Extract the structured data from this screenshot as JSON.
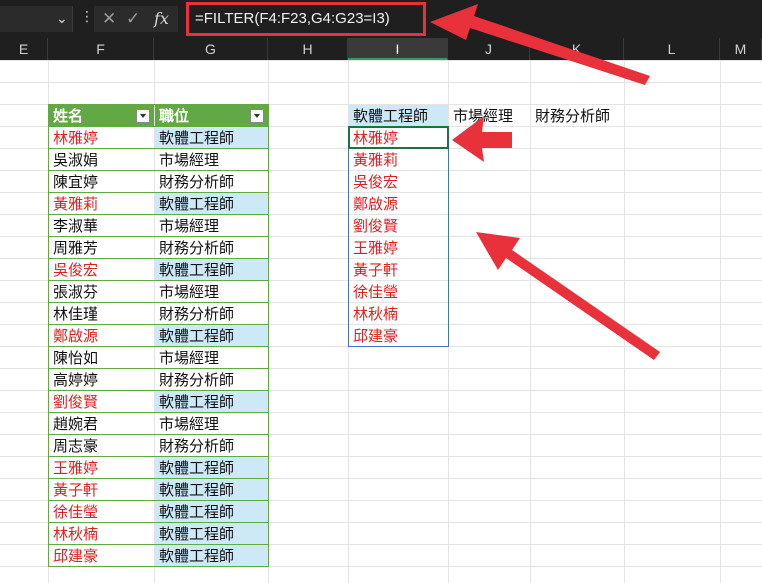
{
  "formula_bar": {
    "formula": "=FILTER(F4:F23,G4:G23=I3)",
    "fx_label": "fx"
  },
  "columns": [
    "E",
    "F",
    "G",
    "H",
    "I",
    "J",
    "K",
    "L",
    "M"
  ],
  "selected_column": "I",
  "table": {
    "headers": [
      "姓名",
      "職位"
    ],
    "rows": [
      {
        "name": "林雅婷",
        "role": "軟體工程師",
        "match": true
      },
      {
        "name": "吳淑娟",
        "role": "市場經理",
        "match": false
      },
      {
        "name": "陳宜婷",
        "role": "財務分析師",
        "match": false
      },
      {
        "name": "黃雅莉",
        "role": "軟體工程師",
        "match": true
      },
      {
        "name": "李淑華",
        "role": "市場經理",
        "match": false
      },
      {
        "name": "周雅芳",
        "role": "財務分析師",
        "match": false
      },
      {
        "name": "吳俊宏",
        "role": "軟體工程師",
        "match": true
      },
      {
        "name": "張淑芬",
        "role": "市場經理",
        "match": false
      },
      {
        "name": "林佳瑾",
        "role": "財務分析師",
        "match": false
      },
      {
        "name": "鄭啟源",
        "role": "軟體工程師",
        "match": true
      },
      {
        "name": "陳怡如",
        "role": "市場經理",
        "match": false
      },
      {
        "name": "高婷婷",
        "role": "財務分析師",
        "match": false
      },
      {
        "name": "劉俊賢",
        "role": "軟體工程師",
        "match": true
      },
      {
        "name": "趙婉君",
        "role": "市場經理",
        "match": false
      },
      {
        "name": "周志豪",
        "role": "財務分析師",
        "match": false
      },
      {
        "name": "王雅婷",
        "role": "軟體工程師",
        "match": true
      },
      {
        "name": "黃子軒",
        "role": "軟體工程師",
        "match": true
      },
      {
        "name": "徐佳瑩",
        "role": "軟體工程師",
        "match": true
      },
      {
        "name": "林秋楠",
        "role": "軟體工程師",
        "match": true
      },
      {
        "name": "邱建豪",
        "role": "軟體工程師",
        "match": true
      }
    ]
  },
  "criteria": {
    "i3": "軟體工程師",
    "j3": "市場經理",
    "k3": "財務分析師"
  },
  "spill_results": [
    "林雅婷",
    "黃雅莉",
    "吳俊宏",
    "鄭啟源",
    "劉俊賢",
    "王雅婷",
    "黃子軒",
    "徐佳瑩",
    "林秋楠",
    "邱建豪"
  ],
  "colors": {
    "table_header": "#62a844",
    "highlight": "#cde8f6",
    "match_text": "#e02020",
    "annotation": "#e8313a"
  }
}
